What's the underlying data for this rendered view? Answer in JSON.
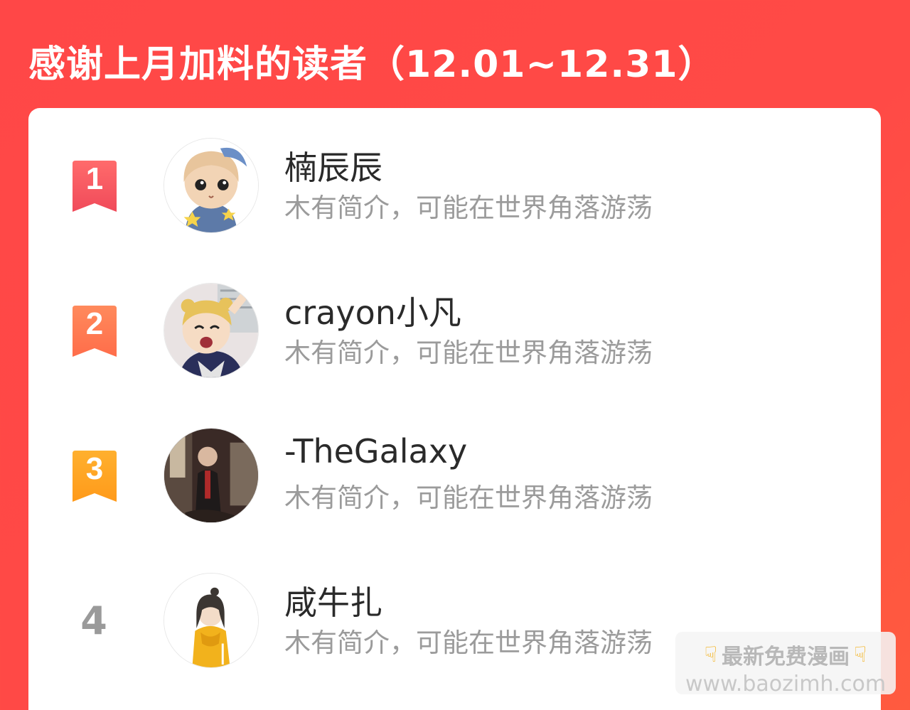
{
  "header": {
    "title": "感谢上月加料的读者（12.01~12.31）"
  },
  "readers": [
    {
      "rank": "1",
      "name": "楠辰辰",
      "bio": "木有简介，可能在世界角落游荡",
      "badge_color_top": "#ff6b6b",
      "badge_color_bottom": "#f04a5a"
    },
    {
      "rank": "2",
      "name": "crayon小凡",
      "bio": "木有简介，可能在世界角落游荡",
      "badge_color_top": "#ff8a5c",
      "badge_color_bottom": "#ff6d4a"
    },
    {
      "rank": "3",
      "name": "-TheGalaxy",
      "bio": "木有简介，可能在世界角落游荡",
      "badge_color_top": "#ffb02e",
      "badge_color_bottom": "#ff9a1a"
    },
    {
      "rank": "4",
      "name": "咸牛扎",
      "bio": "木有简介，可能在世界角落游荡"
    }
  ],
  "watermark": {
    "line1": "最新免费漫画",
    "line2": "www.baozimh.com",
    "hand_icon": "pointing-down-hand-icon"
  },
  "colors": {
    "background": "#ff4747",
    "card": "#ffffff",
    "name": "#2a2a2a",
    "bio": "#9b9b9b",
    "rank_plain": "#9a9a9a"
  }
}
